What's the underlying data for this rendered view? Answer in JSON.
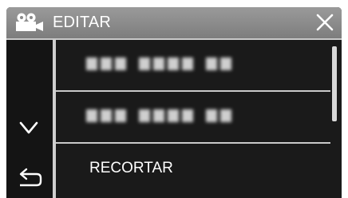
{
  "header": {
    "title": "EDITAR",
    "mode_icon": "movie-camera-icon",
    "close_icon": "close-icon"
  },
  "sidebar": {
    "down_icon": "chevron-down-icon",
    "back_icon": "return-arrow-icon"
  },
  "list": {
    "items": [
      {
        "label": "",
        "blurred": true
      },
      {
        "label": "",
        "blurred": true
      },
      {
        "label": "RECORTAR",
        "blurred": false
      }
    ]
  },
  "scrollbar": {
    "position_fraction": 0.0,
    "visible_fraction": 0.5
  },
  "colors": {
    "header_bg": "#8a8a8a",
    "panel_bg": "#1a1a1a",
    "separator": "#c9c9c9",
    "text": "#ffffff"
  }
}
